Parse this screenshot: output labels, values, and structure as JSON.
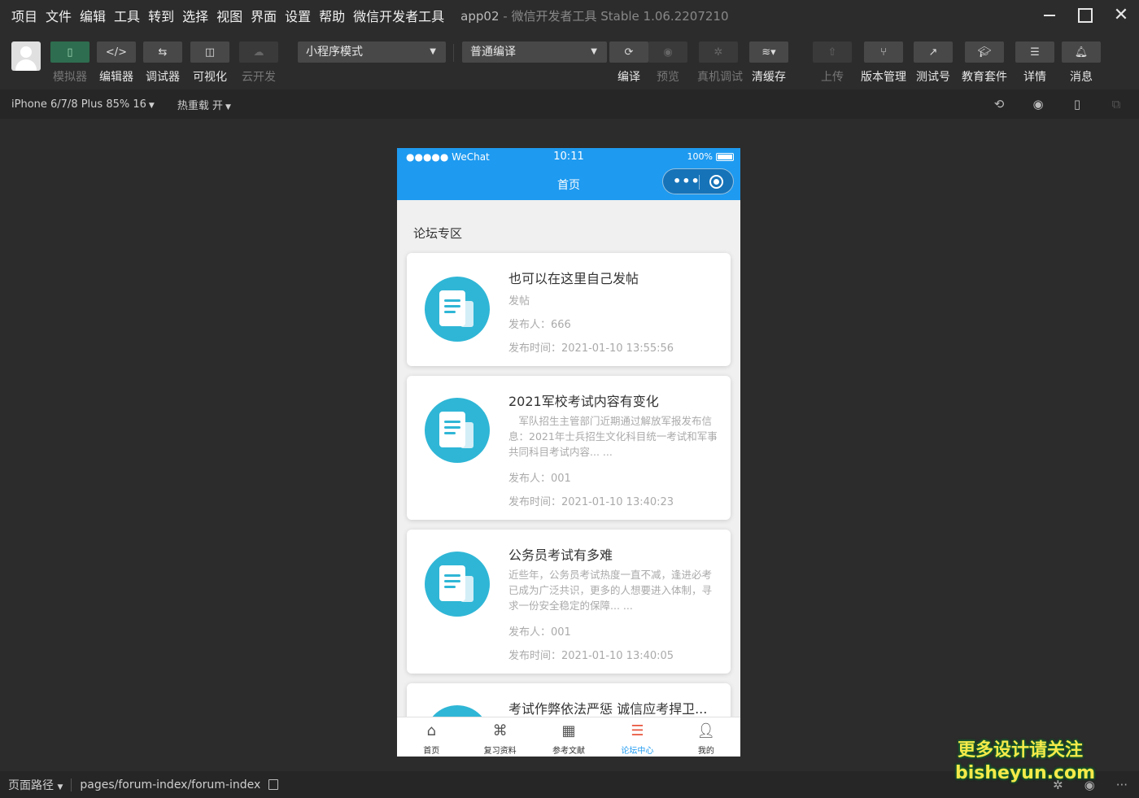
{
  "menu": [
    "项目",
    "文件",
    "编辑",
    "工具",
    "转到",
    "选择",
    "视图",
    "界面",
    "设置",
    "帮助",
    "微信开发者工具"
  ],
  "app_title": {
    "name": "app02",
    "sep": "-",
    "sub": "微信开发者工具 Stable 1.06.2207210"
  },
  "toolbar": {
    "simulator": "模拟器",
    "editor": "编辑器",
    "debugger": "调试器",
    "visual": "可视化",
    "cloud": "云开发",
    "mode_select": "小程序模式",
    "compile_select": "普通编译",
    "compile": "编译",
    "preview": "预览",
    "remote_debug": "真机调试",
    "clear_cache": "清缓存",
    "upload": "上传",
    "version": "版本管理",
    "test_account": "测试号",
    "edu_suite": "教育套件",
    "details": "详情",
    "messages": "消息",
    "editor_icon": "</>"
  },
  "devbar": {
    "device": "iPhone 6/7/8 Plus 85% 16",
    "hot_reload": "热重载 开"
  },
  "phone": {
    "carrier": "●●●●● WeChat",
    "time": "10:11",
    "battery": "100%",
    "nav_title": "首页",
    "capsule_dots": "•••",
    "section_title": "论坛专区",
    "posts": [
      {
        "title": "也可以在这里自己发帖",
        "desc": "发帖",
        "author": "发布人：666",
        "time": "发布时间：2021-01-10 13:55:56"
      },
      {
        "title": "2021军校考试内容有变化",
        "desc": "　军队招生主管部门近期通过解放军报发布信息：2021年士兵招生文化科目统一考试和军事共同科目考试内容... ...",
        "author": "发布人：001",
        "time": "发布时间：2021-01-10 13:40:23"
      },
      {
        "title": "公务员考试有多难",
        "desc": "近些年，公务员考试热度一直不减，逢进必考已成为广泛共识，更多的人想要进入体制，寻求一份安全稳定的保障... ...",
        "author": "发布人：001",
        "time": "发布时间：2021-01-10 13:40:05"
      },
      {
        "title": "考试作弊依法严惩 诚信应考捍卫..."
      }
    ],
    "tabs": [
      {
        "label": "首页",
        "icon": "home-icon"
      },
      {
        "label": "复习资料",
        "icon": "grid-icon"
      },
      {
        "label": "参考文献",
        "icon": "calendar-icon"
      },
      {
        "label": "论坛中心",
        "icon": "list-icon"
      },
      {
        "label": "我的",
        "icon": "user-icon"
      }
    ]
  },
  "pathbar": {
    "label": "页面路径",
    "value": "pages/forum-index/forum-index"
  },
  "watermark": {
    "line1": "更多设计请关注",
    "line2": "bisheyun.com"
  }
}
